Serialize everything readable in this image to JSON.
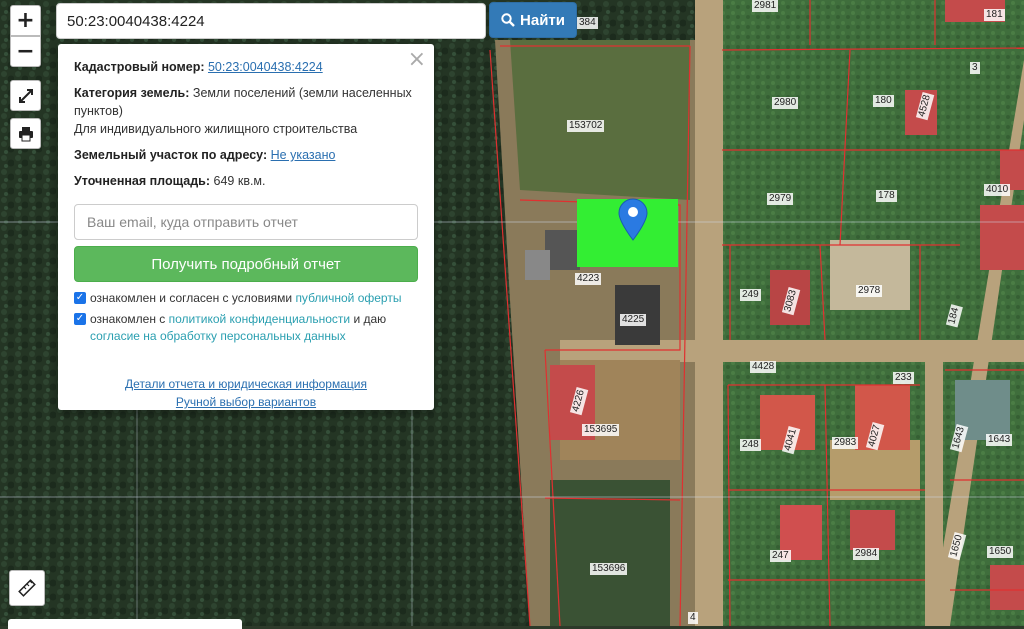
{
  "search": {
    "value": "50:23:0040438:4224",
    "button_label": "Найти",
    "button_icon": "search-icon"
  },
  "controls": {
    "zoom_in": "+",
    "zoom_out": "−",
    "fullscreen_icon": "expand-icon",
    "print_icon": "printer-icon",
    "ruler_icon": "ruler-icon"
  },
  "popup": {
    "cadastral_label": "Кадастровый номер:",
    "cadastral_value": "50:23:0040438:4224",
    "category_label": "Категория земель:",
    "category_value": "Земли поселений (земли населенных пунктов)",
    "usage": "Для индивидуального жилищного строительства",
    "address_label": "Земельный участок по адресу:",
    "address_value": "Не указано",
    "area_label": "Уточненная площадь:",
    "area_value": "649 кв.м.",
    "email_placeholder": "Ваш email, куда отправить отчет",
    "report_button": "Получить подробный отчет",
    "consent1_prefix": "ознакомлен и согласен с условиями ",
    "consent1_link": "публичной оферты",
    "consent2_prefix": "ознакомлен с ",
    "consent2_link": "политикой конфиденциальности",
    "consent2_mid": " и даю ",
    "consent2_link2": "согласие на обработку персональных данных",
    "details_link": "Детали отчета и юридическая информация",
    "manual_link": "Ручной выбор вариантов",
    "close": "×"
  },
  "map_labels": [
    "384",
    "2981",
    "181",
    "3",
    "2980",
    "180",
    "4528",
    "153702",
    "2979",
    "178",
    "4010",
    "4223",
    "249",
    "3083",
    "2978",
    "184",
    "4225",
    "4428",
    "233",
    "4226",
    "153695",
    "248",
    "4041",
    "2983",
    "4027",
    "1643",
    "1643",
    "247",
    "2984",
    "1650",
    "1650",
    "153696",
    "4"
  ],
  "colors": {
    "selected_parcel": "#33ee33",
    "marker": "#2a7ae2",
    "parcel_border": "#e03030",
    "report_button": "#5cb85c",
    "search_button": "#337ab7"
  }
}
